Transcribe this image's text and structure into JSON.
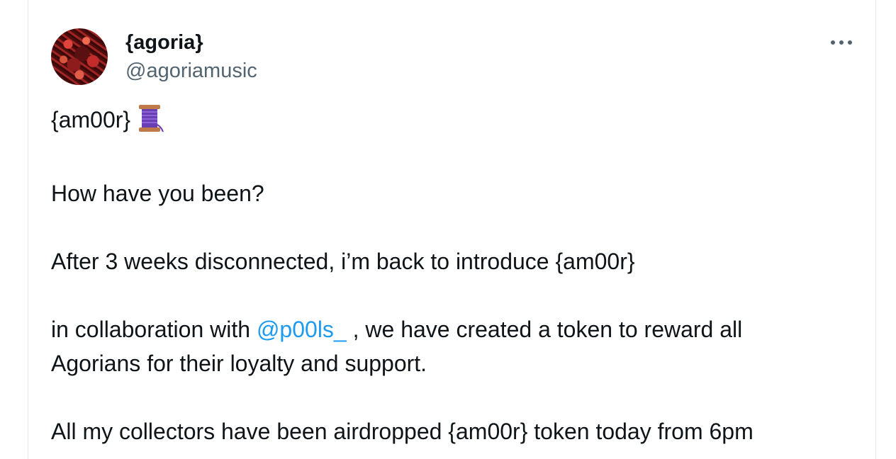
{
  "author": {
    "display_name": "{agoria}",
    "handle": "@agoriamusic"
  },
  "menu": {
    "icon": "more-dots-icon"
  },
  "tweet": {
    "line1": "{am00r}",
    "line1_emoji": "thread-spool-emoji",
    "line2": "How have you been?",
    "line3": "After 3 weeks disconnected, i’m back to introduce {am00r}",
    "line4_before": "in collaboration with ",
    "line4_mention": "@p00ls_",
    "line4_after": " , we have created a token to reward all",
    "line5": "Agorians for their loyalty and support.",
    "line6": "All my collectors have been airdropped {am00r} token today from 6pm"
  },
  "colors": {
    "text": "#0f1419",
    "secondary": "#536471",
    "link": "#1d9bf0",
    "border": "#e4e8eb"
  }
}
